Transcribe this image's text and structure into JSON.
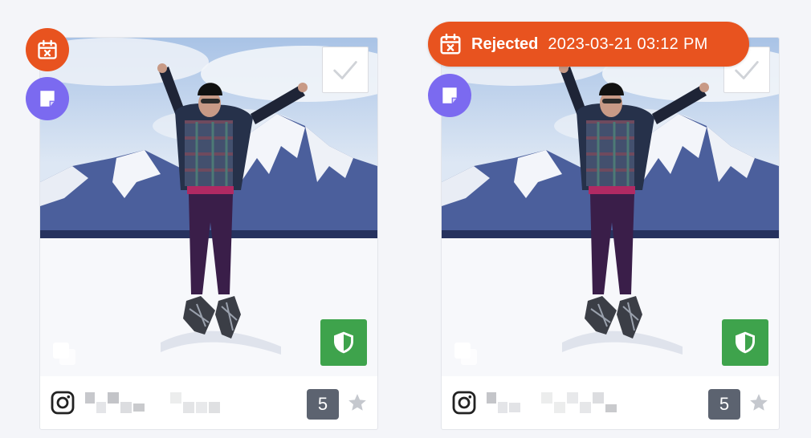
{
  "colors": {
    "rejected": "#e8531f",
    "note": "#7b6af0",
    "rights_approved": "#3ea34c",
    "count_badge": "#5c6370"
  },
  "cards": [
    {
      "source_icon": "instagram-icon",
      "like_count": "5",
      "rights_icon": "shield-icon",
      "status_icon": "calendar-rejected-icon",
      "note_icon": "note-icon"
    },
    {
      "source_icon": "instagram-icon",
      "like_count": "5",
      "rights_icon": "shield-icon",
      "status": "Rejected",
      "status_timestamp": "2023-03-21 03:12 PM",
      "status_icon": "calendar-rejected-icon",
      "note_icon": "note-icon"
    }
  ]
}
